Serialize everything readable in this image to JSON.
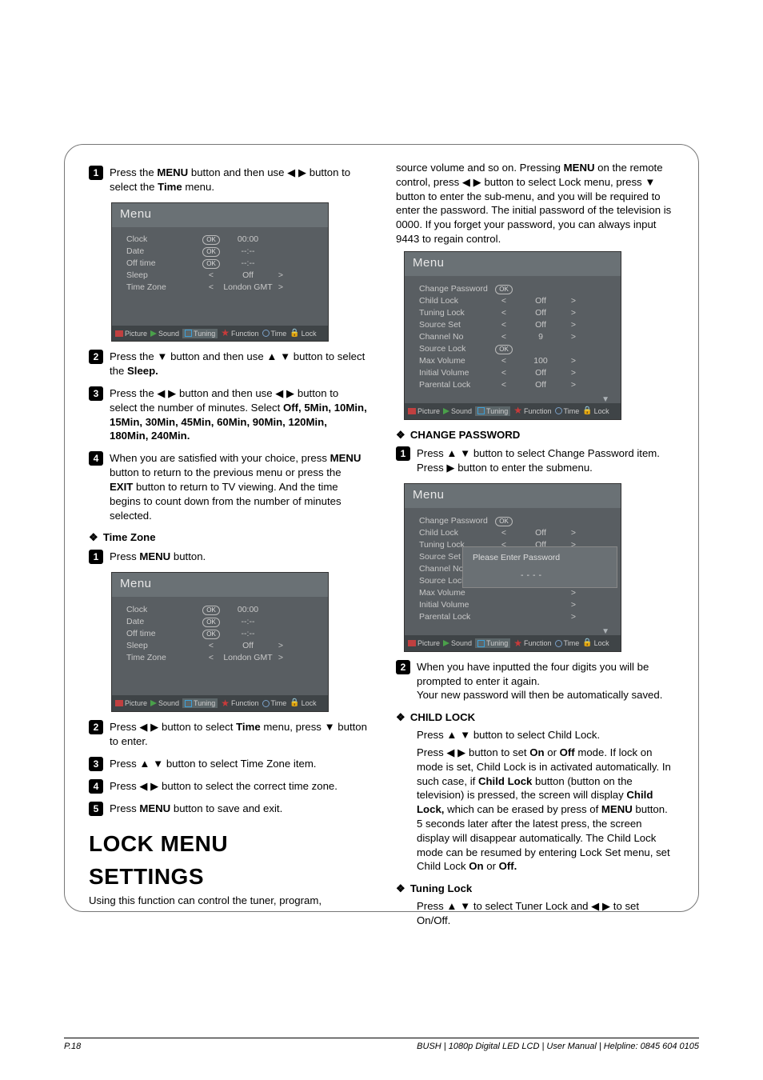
{
  "left": {
    "step1": {
      "pre": "Press the ",
      "b1": "MENU",
      "mid": " button and then use ",
      "arrows": "◀  ▶",
      "post": " button to select the ",
      "b2": "Time",
      "end": " menu."
    },
    "step2": {
      "pre": "Press the ",
      "a1": "▼",
      "mid": " button and then use ",
      "a2": "▲ ▼",
      "post": " button to select the ",
      "b": "Sleep."
    },
    "step3": {
      "pre": "Press the ",
      "a1": "◀  ▶",
      "mid": " button and then use ",
      "a2": "◀  ▶",
      "post": " button to select the number of minutes. Select ",
      "b": "Off, 5Min, 10Min, 15Min, 30Min, 45Min, 60Min, 90Min, 120Min, 180Min, 240Min."
    },
    "step4": {
      "l1": "When you are satisfied with your choice, press ",
      "b1": "MENU",
      "l2": " button to return to the previous menu or press the ",
      "b2": "EXIT",
      "l3": " button to return to TV viewing. And the time begins to count down from the number of minutes selected."
    },
    "tz_head": "Time Zone",
    "tz1": {
      "pre": "Press ",
      "b": "MENU",
      "post": " button."
    },
    "tz2": {
      "pre": "Press ",
      "a1": "◀  ▶",
      "mid": " button to select ",
      "b": "Time",
      "mid2": " menu, press ",
      "a2": "▼",
      "post": " button to enter."
    },
    "tz3": {
      "pre": "Press ",
      "a": "▲ ▼",
      "post": "  button to select Time Zone item."
    },
    "tz4": {
      "pre": "Press ",
      "a": "◀  ▶",
      "post": " button to select the correct time zone."
    },
    "tz5": {
      "pre": "Press ",
      "b": "MENU",
      "post": " button to save and exit."
    },
    "h1": "LOCK MENU",
    "h2": "SETTINGS",
    "tail": "Using this function can control the tuner, program,"
  },
  "right": {
    "intro": {
      "l1": "source volume and so on. Pressing ",
      "b1": "MENU",
      "l2": " on the remote control, press ",
      "a1": "◀  ▶",
      "l3": " button to select Lock menu, press ",
      "a2": "▼",
      "l4": " button to enter the sub-menu, and you will be required to enter the password. The initial password of the television is 0000. If you forget your password, you can always input 9443 to regain control."
    },
    "cp_head": "CHANGE PASSWORD",
    "cp1": {
      "pre": "Press ",
      "a": "▲ ▼",
      "mid": " button to select Change Password item. Press ",
      "a2": "▶",
      "post": " button to enter the submenu."
    },
    "cp2": "When you have inputted the four digits you will be prompted to enter it again.",
    "cp2b": "Your new password will then be automatically saved.",
    "cl_head": "CHILD LOCK",
    "cl1": {
      "pre": "Press ",
      "a": "▲ ▼",
      "post": "  button to select Child Lock."
    },
    "cl2": {
      "pre": "Press ",
      "a": "◀  ▶",
      "mid": " button to set ",
      "b1": "On",
      "mid2": " or ",
      "b2": "Off",
      "mid3": " mode. If lock on mode is set, Child Lock is in activated automatically. In such case, if ",
      "b3": "Child Lock",
      "mid4": " button (button on the television) is pressed, the screen will display ",
      "b4": "Child Lock,",
      "mid5": " which can be erased by press of ",
      "b5": "MENU",
      "mid6": " button. 5 seconds later after the latest press, the screen display will disappear automatically. The Child Lock mode can be resumed by entering Lock Set menu, set Child Lock ",
      "b6": "On",
      "mid7": " or ",
      "b7": "Off."
    },
    "tl_head": "Tuning Lock",
    "tl1": {
      "pre": "Press ",
      "a1": "▲ ▼",
      "mid": " to select Tuner Lock and ",
      "a2": "◀  ▶",
      "post": " to set On/Off."
    }
  },
  "osd_time": {
    "title": "Menu",
    "rows": [
      {
        "label": "Clock",
        "pre": "OK",
        "val": "00:00",
        "post": ""
      },
      {
        "label": "Date",
        "pre": "OK",
        "val": "--:--",
        "post": ""
      },
      {
        "label": "Off time",
        "pre": "OK",
        "val": "--:--",
        "post": ""
      },
      {
        "label": "Sleep",
        "pre": "<",
        "val": "Off",
        "post": ">"
      },
      {
        "label": "Time Zone",
        "pre": "<",
        "val": "London GMT",
        "post": ">"
      }
    ]
  },
  "osd_lock": {
    "title": "Menu",
    "rows": [
      {
        "label": "Change Password",
        "pre": "OK",
        "val": "",
        "post": ""
      },
      {
        "label": "Child Lock",
        "pre": "<",
        "val": "Off",
        "post": ">"
      },
      {
        "label": "Tuning Lock",
        "pre": "<",
        "val": "Off",
        "post": ">"
      },
      {
        "label": "Source Set",
        "pre": "<",
        "val": "Off",
        "post": ">"
      },
      {
        "label": "Channel No",
        "pre": "<",
        "val": "9",
        "post": ">"
      },
      {
        "label": "Source Lock",
        "pre": "OK",
        "val": "",
        "post": ""
      },
      {
        "label": "Max Volume",
        "pre": "<",
        "val": "100",
        "post": ">"
      },
      {
        "label": "Initial Volume",
        "pre": "<",
        "val": "Off",
        "post": ">"
      },
      {
        "label": "Parental Lock",
        "pre": "<",
        "val": "Off",
        "post": ">"
      }
    ]
  },
  "osd_lock2": {
    "title": "Menu",
    "rows": [
      {
        "label": "Change Password",
        "pre": "OK",
        "val": "",
        "post": ""
      },
      {
        "label": "Child Lock",
        "pre": "<",
        "val": "Off",
        "post": ">"
      },
      {
        "label": "Tuning Lock",
        "pre": "<",
        "val": "Off",
        "post": ">"
      },
      {
        "label": "Source Set",
        "pre": "",
        "val": "",
        "post": ">"
      },
      {
        "label": "Channel No",
        "pre": "",
        "val": "",
        "post": ">"
      },
      {
        "label": "Source Lock",
        "pre": "",
        "val": "",
        "post": ""
      },
      {
        "label": "Max Volume",
        "pre": "",
        "val": "",
        "post": ">"
      },
      {
        "label": "Initial Volume",
        "pre": "",
        "val": "",
        "post": ">"
      },
      {
        "label": "Parental Lock",
        "pre": "",
        "val": "",
        "post": ">"
      }
    ],
    "overlay_title": "Please Enter Password",
    "overlay_val": "----"
  },
  "osd_footer": {
    "picture": "Picture",
    "sound": "Sound",
    "tuning": "Tuning",
    "function": "Function",
    "time": "Time",
    "lock": "Lock"
  },
  "footer": {
    "left": "P.18",
    "right": "BUSH  | 1080p  Digital LED LCD | User Manual | Helpline: 0845 604 0105"
  }
}
